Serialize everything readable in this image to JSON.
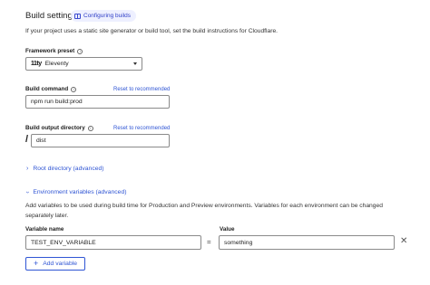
{
  "header": {
    "title": "Build settings",
    "docs_link": "Configuring builds",
    "description": "If your project uses a static site generator or build tool, set the build instructions for Cloudflare."
  },
  "framework": {
    "label": "Framework preset",
    "value": "Eleventy",
    "logo_text": "11ty"
  },
  "build_command": {
    "label": "Build command",
    "reset": "Reset to recommended",
    "value": "npm run build:prod"
  },
  "output_dir": {
    "label": "Build output directory",
    "reset": "Reset to recommended",
    "prefix": "/",
    "value": "dist"
  },
  "root_directory": {
    "label": "Root directory (advanced)",
    "icon": "chevron-right-icon"
  },
  "env": {
    "label": "Environment variables (advanced)",
    "icon": "chevron-down-icon",
    "description": "Add variables to be used during build time for Production and Preview environments. Variables for each environment can be changed separately later.",
    "name_header": "Variable name",
    "value_header": "Value",
    "rows": [
      {
        "name": "TEST_ENV_VARIABLE",
        "eq": "=",
        "value": "something"
      }
    ],
    "add_label": "Add variable"
  },
  "colors": {
    "link": "#2f55d4",
    "pill_bg": "#eef0ff"
  }
}
